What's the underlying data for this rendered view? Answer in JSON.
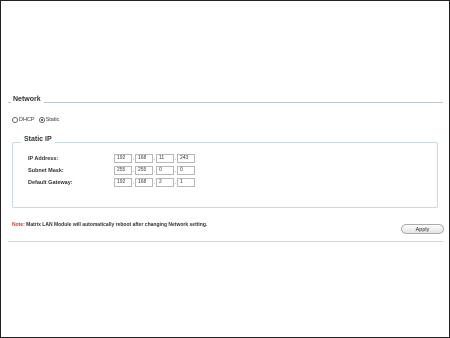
{
  "network": {
    "title": "Network",
    "modes": [
      {
        "label": "DHCP",
        "selected": false
      },
      {
        "label": "Static",
        "selected": true
      }
    ]
  },
  "static_ip": {
    "title": "Static IP",
    "ip_address": {
      "label": "IP Address:",
      "octets": [
        "192",
        "168",
        "11",
        "243"
      ]
    },
    "subnet_mask": {
      "label": "Subnet Mask:",
      "octets": [
        "255",
        "255",
        "0",
        "0"
      ]
    },
    "default_gateway": {
      "label": "Default Gateway:",
      "octets": [
        "192",
        "168",
        "2",
        "1"
      ]
    }
  },
  "note": {
    "tag": "Note:",
    "text": " Matrix LAN Module will automatically reboot after changing Network setting."
  },
  "apply_button": {
    "label": "Apply"
  },
  "colors": {
    "note_accent": "#d6342c",
    "box_border": "#c9dbe7"
  }
}
